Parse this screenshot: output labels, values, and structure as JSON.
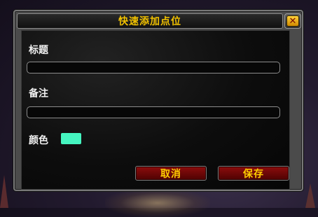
{
  "dialog": {
    "title": "快速添加点位",
    "close_icon": "close-icon",
    "fields": {
      "title_label": "标题",
      "title_value": "",
      "note_label": "备注",
      "note_value": "",
      "color_label": "颜色",
      "color_value": "#45f5c0"
    },
    "buttons": {
      "cancel": "取消",
      "save": "保存"
    }
  },
  "colors": {
    "title_text": "#f2c200",
    "button_text": "#ffcf00",
    "button_bg": "#7a0808"
  }
}
